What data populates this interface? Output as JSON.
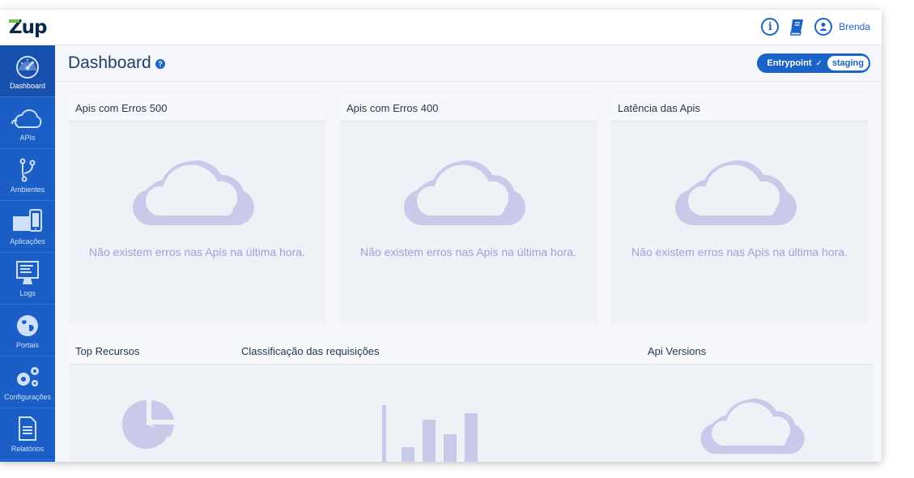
{
  "topbar": {
    "logo_text": "Zup",
    "user_name": "Brenda",
    "icons": [
      "info-icon",
      "book-icon",
      "user-icon"
    ]
  },
  "sidebar": {
    "items": [
      {
        "label": "Dashboard",
        "icon": "speedometer-icon",
        "active": true
      },
      {
        "label": "APIs",
        "icon": "cloud-icon"
      },
      {
        "label": "Ambientes",
        "icon": "branch-icon"
      },
      {
        "label": "Aplicações",
        "icon": "devices-icon"
      },
      {
        "label": "Logs",
        "icon": "monitor-icon"
      },
      {
        "label": "Portais",
        "icon": "globe-icon"
      },
      {
        "label": "Configurações",
        "icon": "gears-icon"
      },
      {
        "label": "Relatórios",
        "icon": "document-icon"
      }
    ]
  },
  "header": {
    "title": "Dashboard",
    "env_label": "Entrypoint",
    "env_value": "staging"
  },
  "cards": {
    "erros500": {
      "title": "Apis com Erros 500",
      "empty": "Não existem erros nas Apis na última hora."
    },
    "erros400": {
      "title": "Apis com Erros 400",
      "empty": "Não existem erros nas Apis na última hora."
    },
    "latencia": {
      "title": "Latência das Apis",
      "empty": "Não existem erros nas Apis na última hora."
    },
    "top_recursos": {
      "title": "Top Recursos"
    },
    "classificacao": {
      "title": "Classificação das requisições"
    },
    "api_versions": {
      "title": "Api Versions"
    }
  },
  "colors": {
    "primary": "#1c63c7",
    "sidebar": "#1b5fc6",
    "placeholder": "#c9c9e9",
    "empty_text": "#9da2d8"
  }
}
